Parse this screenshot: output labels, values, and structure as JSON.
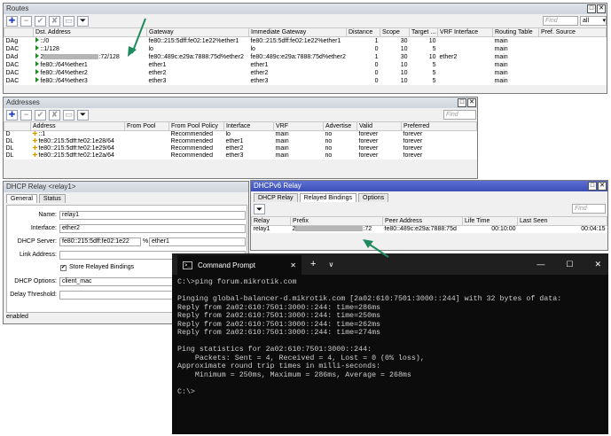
{
  "routes": {
    "title": "Routes",
    "find_placeholder": "Find",
    "filter_value": "all",
    "columns": [
      "",
      "Dst. Address",
      "Gateway",
      "Immediate Gateway",
      "Distance",
      "Scope",
      "Target ...",
      "VRF Interface",
      "Routing Table",
      "Pref. Source"
    ],
    "rows": [
      {
        "flag": "DAg",
        "dst": "::/0",
        "gateway": "fe80::215:5dff:fe02:1e22%ether1",
        "immediate": "fe80::215:5dff:fe02:1e22%ether1",
        "distance": "1",
        "scope": "30",
        "target": "10",
        "vrf": "",
        "table": "main"
      },
      {
        "flag": "DAC",
        "dst": "::1/128",
        "gateway": "lo",
        "immediate": "lo",
        "distance": "0",
        "scope": "10",
        "target": "5",
        "vrf": "",
        "table": "main"
      },
      {
        "flag": "DAd",
        "dst": "2",
        "dst_suffix": ":72/128",
        "gateway": "fe80::489c:e29a:7888:75d%ether2",
        "immediate": "fe80::489c:e29a:7888:75d%ether2",
        "distance": "1",
        "scope": "30",
        "target": "10",
        "vrf": "ether2",
        "table": "main"
      },
      {
        "flag": "DAC",
        "dst": "fe80::/64%ether1",
        "gateway": "ether1",
        "immediate": "ether1",
        "distance": "0",
        "scope": "10",
        "target": "5",
        "vrf": "",
        "table": "main"
      },
      {
        "flag": "DAC",
        "dst": "fe80::/64%ether2",
        "gateway": "ether2",
        "immediate": "ether2",
        "distance": "0",
        "scope": "10",
        "target": "5",
        "vrf": "",
        "table": "main"
      },
      {
        "flag": "DAC",
        "dst": "fe80::/64%ether3",
        "gateway": "ether3",
        "immediate": "ether3",
        "distance": "0",
        "scope": "10",
        "target": "5",
        "vrf": "",
        "table": "main"
      }
    ]
  },
  "addresses": {
    "title": "Addresses",
    "find_placeholder": "Find",
    "columns": [
      "",
      "Address",
      "From Pool",
      "From Pool Policy",
      "Interface",
      "VRF",
      "Advertise",
      "Valid",
      "Preferred"
    ],
    "rows": [
      {
        "flag": "D",
        "address": "::1",
        "pool": "",
        "policy": "Recommended",
        "iface": "lo",
        "vrf": "main",
        "advertise": "no",
        "valid": "forever",
        "preferred": "forever"
      },
      {
        "flag": "DL",
        "address": "fe80::215:5dff:fe02:1e28/64",
        "pool": "",
        "policy": "Recommended",
        "iface": "ether1",
        "vrf": "main",
        "advertise": "no",
        "valid": "forever",
        "preferred": "forever"
      },
      {
        "flag": "DL",
        "address": "fe80::215:5dff:fe02:1e29/64",
        "pool": "",
        "policy": "Recommended",
        "iface": "ether2",
        "vrf": "main",
        "advertise": "no",
        "valid": "forever",
        "preferred": "forever"
      },
      {
        "flag": "DL",
        "address": "fe80::215:5dff:fe02:1e2a/64",
        "pool": "",
        "policy": "Recommended",
        "iface": "ether3",
        "vrf": "main",
        "advertise": "no",
        "valid": "forever",
        "preferred": "forever"
      }
    ]
  },
  "dhcp_relay": {
    "title": "DHCP Relay <relay1>",
    "tabs": [
      "General",
      "Status"
    ],
    "name_label": "Name:",
    "name_value": "relay1",
    "interface_label": "Interface:",
    "interface_value": "ether2",
    "server_label": "DHCP Server:",
    "server_value": "fe80::215:5dff:fe02:1e22",
    "server_sep": "%",
    "server_iface": "ether1",
    "link_label": "Link Address:",
    "store_label": "Store Relayed Bindings",
    "options_label": "DHCP Options:",
    "options_value": "client_mac",
    "delay_label": "Delay Threshold:",
    "status": "enabled"
  },
  "dhcpv6_relay": {
    "title": "DHCPv6 Relay",
    "tabs": [
      "DHCP Relay",
      "Relayed Bindings",
      "Options"
    ],
    "find_placeholder": "Find",
    "columns": [
      "Relay",
      "Prefix",
      "Peer Address",
      "Life Time",
      "Last Seen"
    ],
    "row": {
      "relay": "relay1",
      "prefix": "2",
      "prefix_suffix": ":72",
      "peer": "fe80::489c:e29a:7888:75d",
      "life": "00:10:00",
      "last_seen": "00:04:15"
    }
  },
  "cmd": {
    "tab_title": "Command Prompt",
    "new_tab": "+",
    "dropdown": "∨",
    "lines": [
      "C:\\>ping forum.mikrotik.com",
      "",
      "Pinging global-balancer-d.mikrotik.com [2a02:610:7501:3000::244] with 32 bytes of data:",
      "Reply from 2a02:610:7501:3000::244: time=286ms",
      "Reply from 2a02:610:7501:3000::244: time=250ms",
      "Reply from 2a02:610:7501:3000::244: time=262ms",
      "Reply from 2a02:610:7501:3000::244: time=274ms",
      "",
      "Ping statistics for 2a02:610:7501:3000::244:",
      "    Packets: Sent = 4, Received = 4, Lost = 0 (0% loss),",
      "Approximate round trip times in milli-seconds:",
      "    Minimum = 250ms, Maximum = 286ms, Average = 268ms",
      "",
      "C:\\>"
    ]
  },
  "colors": {
    "arrow": "#1f8a5e",
    "route_icon": "#1b8b1b",
    "cmd_bg": "#0c0c0c",
    "active_title": "#3c4fb9"
  }
}
